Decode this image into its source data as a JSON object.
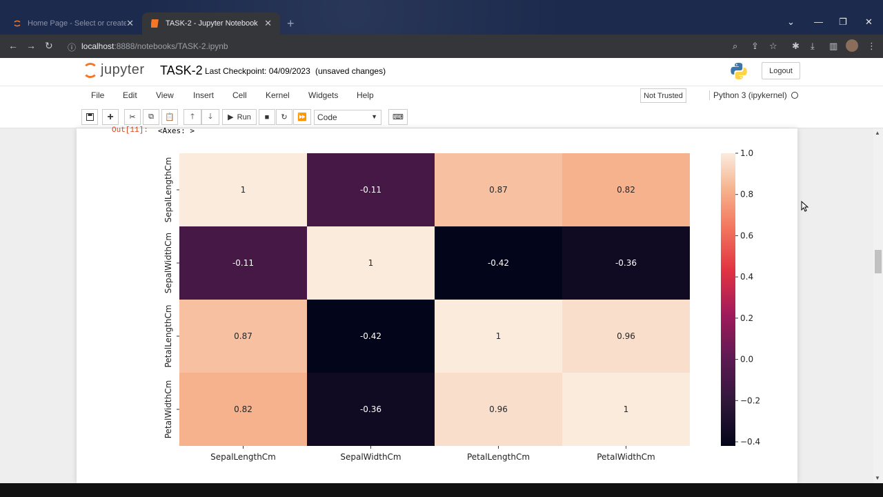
{
  "browser": {
    "tabs": [
      {
        "label": "Home Page - Select or create a n",
        "active": false
      },
      {
        "label": "TASK-2 - Jupyter Notebook",
        "active": true
      }
    ],
    "new_tab": "+",
    "url_host": "localhost",
    "url_path": ":8888/notebooks/TASK-2.ipynb"
  },
  "jupyter": {
    "logo_text": "jupyter",
    "notebook_title": "TASK-2",
    "checkpoint": "Last Checkpoint: 04/09/2023",
    "unsaved": "(unsaved changes)",
    "logout": "Logout",
    "menu": [
      "File",
      "Edit",
      "View",
      "Insert",
      "Cell",
      "Kernel",
      "Widgets",
      "Help"
    ],
    "trust": "Not Trusted",
    "kernel": "Python 3 (ipykernel)",
    "toolbar": {
      "run_label": "Run",
      "cell_type": "Code"
    }
  },
  "output": {
    "prompt": "Out[11]:",
    "text": "<Axes: >"
  },
  "chart_data": {
    "type": "heatmap",
    "rows": [
      "SepalLengthCm",
      "SepalWidthCm",
      "PetalLengthCm",
      "PetalWidthCm"
    ],
    "columns": [
      "SepalLengthCm",
      "SepalWidthCm",
      "PetalLengthCm",
      "PetalWidthCm"
    ],
    "values": [
      [
        1,
        -0.11,
        0.87,
        0.82
      ],
      [
        -0.11,
        1,
        -0.42,
        -0.36
      ],
      [
        0.87,
        -0.42,
        1,
        0.96
      ],
      [
        0.82,
        -0.36,
        0.96,
        1
      ]
    ],
    "labels": [
      [
        "1",
        "-0.11",
        "0.87",
        "0.82"
      ],
      [
        "-0.11",
        "1",
        "-0.42",
        "-0.36"
      ],
      [
        "0.87",
        "-0.42",
        "1",
        "0.96"
      ],
      [
        "0.82",
        "-0.36",
        "0.96",
        "1"
      ]
    ],
    "colorbar": {
      "min": -0.42,
      "max": 1.0,
      "ticks": [
        "1.0",
        "0.8",
        "0.6",
        "0.4",
        "0.2",
        "0.0",
        "−0.2",
        "−0.4"
      ],
      "tick_values": [
        1.0,
        0.8,
        0.6,
        0.4,
        0.2,
        0.0,
        -0.2,
        -0.4
      ]
    },
    "colormap": "rocket",
    "annotated": true
  }
}
